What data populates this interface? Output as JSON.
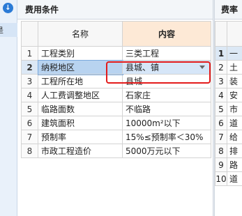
{
  "left_panel": {
    "icon": "down-arrow-icon",
    "item_text": "是"
  },
  "fee_panel": {
    "title": "费用条件",
    "columns": [
      "名称",
      "内容"
    ],
    "rows": [
      {
        "num": "1",
        "name": "工程类别",
        "value": "三类工程"
      },
      {
        "num": "2",
        "name": "纳税地区",
        "value": "县城、镇"
      },
      {
        "num": "3",
        "name": "工程所在地",
        "value": "县城"
      },
      {
        "num": "4",
        "name": "人工费调整地区",
        "value": "石家庄"
      },
      {
        "num": "5",
        "name": "临路面数",
        "value": "不临路"
      },
      {
        "num": "6",
        "name": "建筑面积",
        "value": "10000m²以下"
      },
      {
        "num": "7",
        "name": "预制率",
        "value": "15%≤预制率＜30%"
      },
      {
        "num": "8",
        "name": "市政工程造价",
        "value": "5000万元以下"
      }
    ]
  },
  "rate_panel": {
    "title": "费率",
    "rows": [
      {
        "num": "1",
        "text": "一"
      },
      {
        "num": "2",
        "text": "土"
      },
      {
        "num": "3",
        "text": "装"
      },
      {
        "num": "4",
        "text": "安"
      },
      {
        "num": "5",
        "text": "市"
      },
      {
        "num": "6",
        "text": "道"
      },
      {
        "num": "7",
        "text": "给"
      },
      {
        "num": "8",
        "text": "排"
      },
      {
        "num": "9",
        "text": "路"
      },
      {
        "num": "10",
        "text": "道"
      }
    ]
  }
}
